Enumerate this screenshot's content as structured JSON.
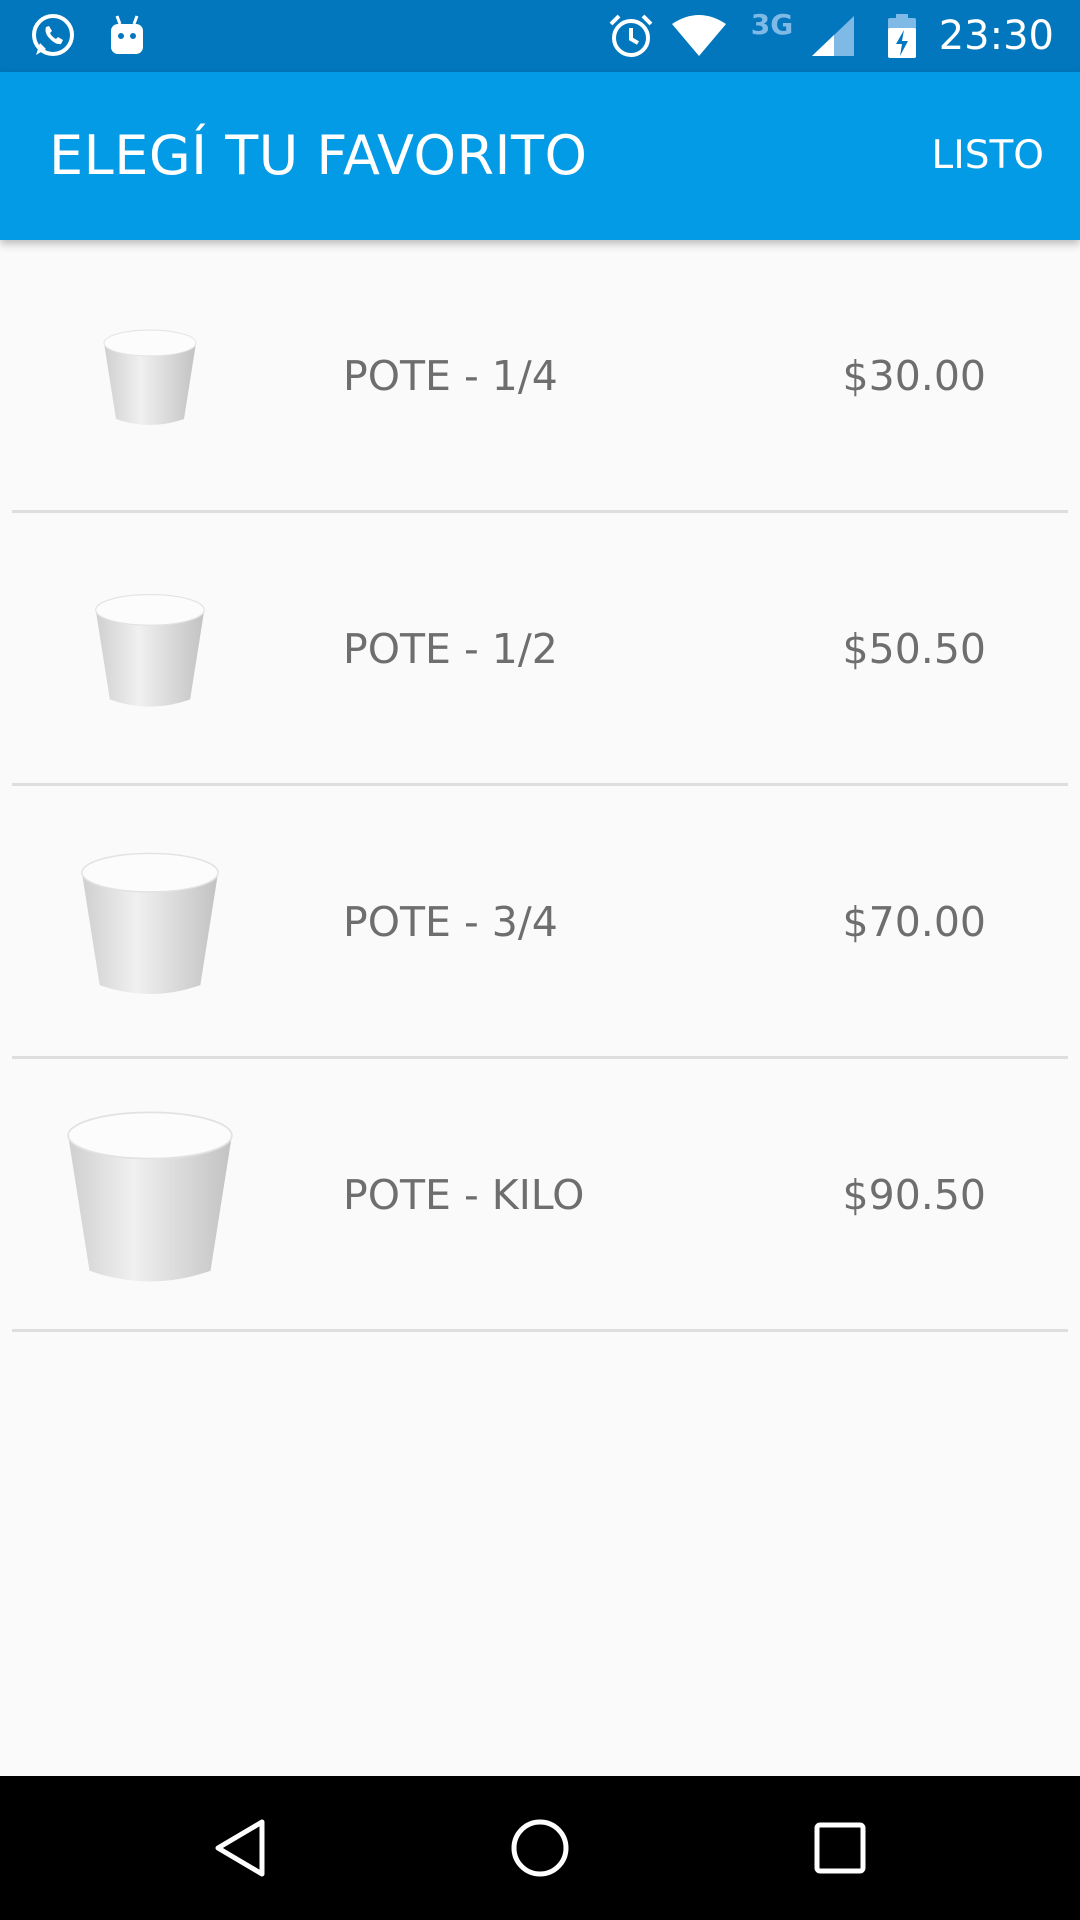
{
  "status_bar": {
    "time": "23:30",
    "network": "3G",
    "icons": [
      "whatsapp-icon",
      "android-icon",
      "alarm-icon",
      "wifi-icon",
      "cell-signal-icon",
      "battery-charging-icon"
    ]
  },
  "app_bar": {
    "title": "ELEGÍ TU FAVORITO",
    "action_label": "LISTO",
    "color": "#039be5"
  },
  "products": [
    {
      "name": "POTE - 1/4",
      "price": "$30.00",
      "icon": "cup-icon"
    },
    {
      "name": "POTE - 1/2",
      "price": "$50.50",
      "icon": "cup-icon"
    },
    {
      "name": "POTE - 3/4",
      "price": "$70.00",
      "icon": "cup-icon"
    },
    {
      "name": "POTE - KILO",
      "price": "$90.50",
      "icon": "cup-icon"
    }
  ],
  "nav_bar": {
    "buttons": [
      "back-icon",
      "home-icon",
      "recents-icon"
    ]
  }
}
